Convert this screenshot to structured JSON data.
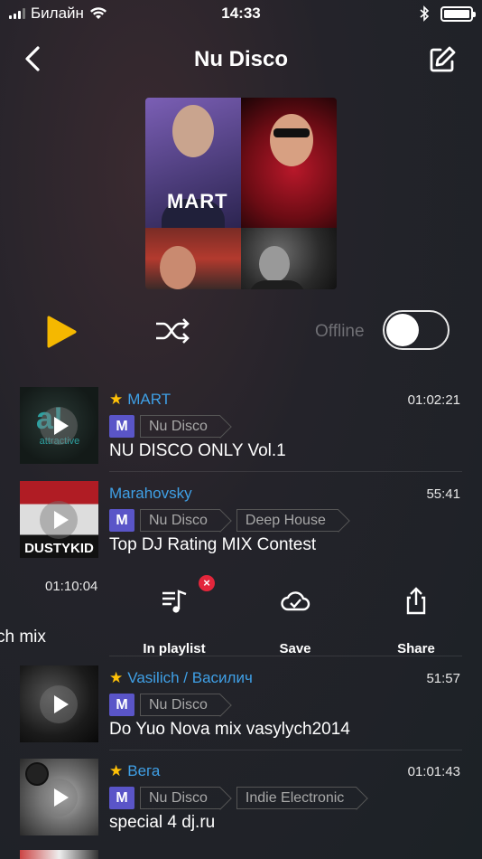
{
  "status_bar": {
    "carrier": "Билайн",
    "time": "14:33",
    "wifi_icon": "wifi-icon",
    "bluetooth_icon": "bluetooth-icon",
    "battery_level": 1.0
  },
  "nav": {
    "title": "Nu Disco",
    "back_icon": "chevron-left-icon",
    "edit_icon": "edit-icon"
  },
  "cover": {
    "logo_text": "MART"
  },
  "controls": {
    "play_icon": "play-icon",
    "shuffle_icon": "shuffle-icon",
    "offline_label": "Offline",
    "offline_enabled": false,
    "accent_color": "#f5b800"
  },
  "tracks": [
    {
      "artist": "MART",
      "starred": true,
      "duration": "01:02:21",
      "badge": "M",
      "tags": [
        "Nu Disco"
      ],
      "title": "NU DISCO ONLY Vol.1"
    },
    {
      "artist": "Marahovsky",
      "starred": false,
      "duration": "55:41",
      "badge": "M",
      "tags": [
        "Nu Disco",
        "Deep House"
      ],
      "title": "Top DJ Rating MIX Contest"
    },
    {
      "artist": "Vasilich / Василич",
      "starred": true,
      "duration": "51:57",
      "badge": "M",
      "tags": [
        "Nu Disco"
      ],
      "title": "Do Yuo Nova mix vasylych2014"
    },
    {
      "artist": "Вега",
      "starred": true,
      "duration": "01:01:43",
      "badge": "M",
      "tags": [
        "Nu Disco",
        "Indie Electronic"
      ],
      "title": "special 4 dj.ru"
    }
  ],
  "swiped_row": {
    "duration": "01:10:04",
    "title_fragment": "ch mix",
    "actions": [
      {
        "label": "In playlist",
        "icon": "playlist-icon",
        "badge": "×"
      },
      {
        "label": "Save",
        "icon": "cloud-save-icon"
      },
      {
        "label": "Share",
        "icon": "share-icon"
      }
    ]
  },
  "colors": {
    "artist_link": "#3fa0e6",
    "star": "#ffc107",
    "badge_bg": "#5a55c8",
    "remove_badge": "#e3263b"
  }
}
